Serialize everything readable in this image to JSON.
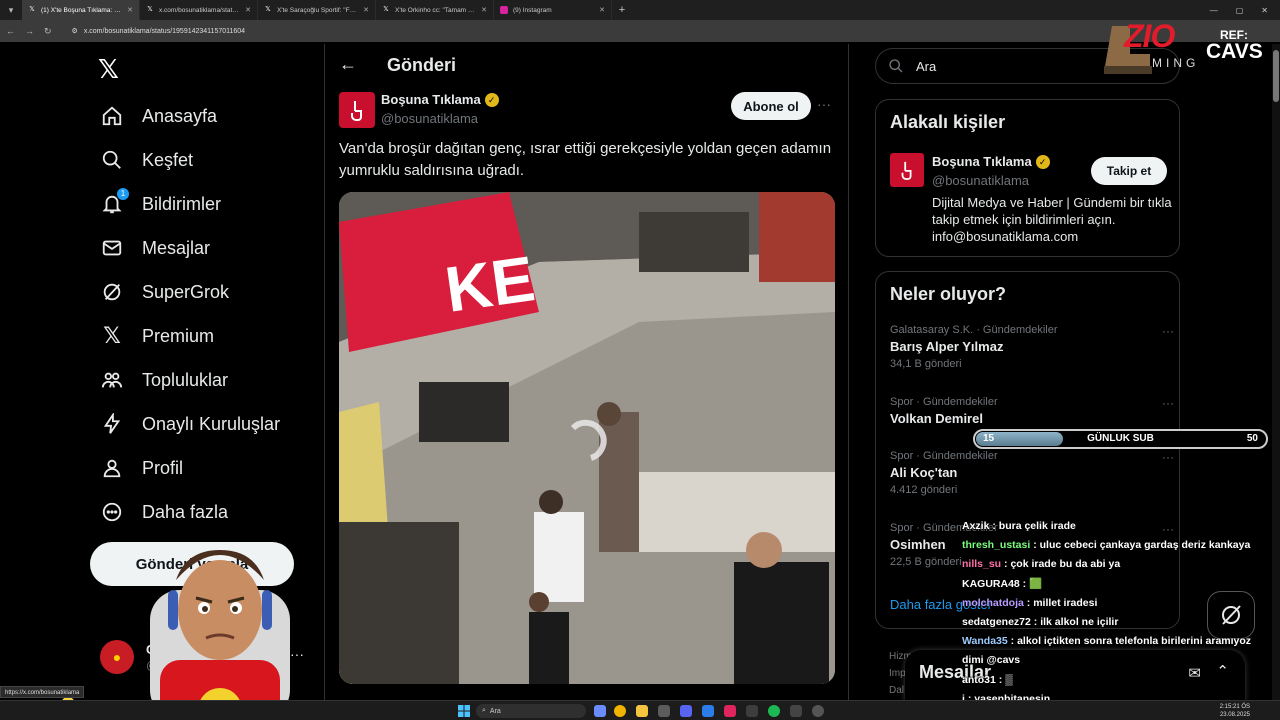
{
  "browser": {
    "tabs": [
      {
        "title": "(1) X'te Boşuna Tıklama: \"Van'da",
        "active": true
      },
      {
        "title": "x.com/bosunatiklama/status/19",
        "active": false
      },
      {
        "title": "X'te Saraçoğlu Sportif: \"Fenerba",
        "active": false
      },
      {
        "title": "X'te Orkinho cc: \"Tamam mı de",
        "active": false
      },
      {
        "title": "(9) Instagram",
        "active": false
      }
    ],
    "url": "x.com/bosunatiklama/status/1959142341157011604",
    "status_url": "https://x.com/bosunatiklama"
  },
  "nav": {
    "items": [
      {
        "label": "Anasayfa",
        "icon": "home-icon"
      },
      {
        "label": "Keşfet",
        "icon": "search-icon"
      },
      {
        "label": "Bildirimler",
        "icon": "bell-icon",
        "badge": "1"
      },
      {
        "label": "Mesajlar",
        "icon": "mail-icon"
      },
      {
        "label": "SuperGrok",
        "icon": "grok-icon"
      },
      {
        "label": "Premium",
        "icon": "x-icon"
      },
      {
        "label": "Topluluklar",
        "icon": "people-icon"
      },
      {
        "label": "Onaylı Kuruluşlar",
        "icon": "lightning-icon"
      },
      {
        "label": "Profil",
        "icon": "person-icon"
      },
      {
        "label": "Daha fazla",
        "icon": "more-circle-icon"
      }
    ],
    "post_button": "Gönderi yayınla",
    "account_name": "C",
    "account_handle": "@c",
    "account_more": "···"
  },
  "main": {
    "title": "Gönderi",
    "author_name": "Boşuna Tıklama",
    "author_handle": "@bosunatiklama",
    "follow_label": "Abone ol",
    "more": "···",
    "post_text": "Van'da broşür dağıtan genç, ısrar ettiği gerekçesiyle yoldan geçen adamın yumruklu saldırısına uğradı.",
    "media_sign": "KE"
  },
  "right": {
    "search_placeholder": "Ara",
    "related": {
      "title": "Alakalı kişiler",
      "name": "Boşuna Tıklama",
      "handle": "@bosunatiklama",
      "follow_label": "Takip et",
      "bio": "Dijital Medya ve Haber | Gündemi bir tıkla takip etmek için bildirimleri açın. info@bosunatiklama.com"
    },
    "trends_title": "Neler oluyor?",
    "trends": [
      {
        "context": "Galatasaray S.K. · Gündemdekiler",
        "topic": "Barış Alper Yılmaz",
        "count": "34,1 B gönderi"
      },
      {
        "context": "Spor · Gündemdekiler",
        "topic": "Volkan Demirel",
        "count": ""
      },
      {
        "context": "Spor · Gündemdekiler",
        "topic": "Ali Koç'tan",
        "count": "4.412 gönderi"
      },
      {
        "context": "Spor · Gündemdekiler",
        "topic": "Osimhen",
        "count": "22,5 B gönderi"
      }
    ],
    "show_more": "Daha fazla göster",
    "footer": [
      "Hizm",
      "Imp",
      "Dal"
    ],
    "messages_title": "Mesajlar"
  },
  "overlay": {
    "brand": "ZIO",
    "brand_sub": "MING",
    "ref_label": "REF:",
    "ref_code": "CAVS",
    "sub_goal": {
      "current": "15",
      "label": "GÜNLUK SUB",
      "target": "50",
      "progress": 0.3
    },
    "chat": [
      {
        "user": "Axzik",
        "color": "#ffffff",
        "msg": "bura çelik irade"
      },
      {
        "user": "thresh_ustasi",
        "color": "#7cfc7c",
        "msg": "uluc cebeci çankaya gardaş deriz kankaya"
      },
      {
        "user": "nills_su",
        "color": "#ff6fa8",
        "msg": "çok irade bu da abi ya"
      },
      {
        "user": "KAGURA48",
        "color": "#ffffff",
        "msg": "🟩"
      },
      {
        "user": "molchatdoja",
        "color": "#b99cff",
        "msg": "millet iradesi"
      },
      {
        "user": "sedatgenez72",
        "color": "#ffffff",
        "msg": "ilk alkol ne içilir"
      },
      {
        "user": "Wanda35",
        "color": "#9ecbff",
        "msg": "alkol içtikten sonra telefonla birilerini aramıyoz"
      },
      {
        "user": "",
        "color": "#ffffff",
        "msg": "dimi @cavs"
      },
      {
        "user": "anto31",
        "color": "#ffffff",
        "msg": "▒"
      },
      {
        "user": "i",
        "color": "#ffffff",
        "msg": "yasenbitanesin"
      }
    ]
  },
  "taskbar": {
    "search": "Ara",
    "time": "2:15:21 ÖS",
    "date": "23.08.2025"
  }
}
